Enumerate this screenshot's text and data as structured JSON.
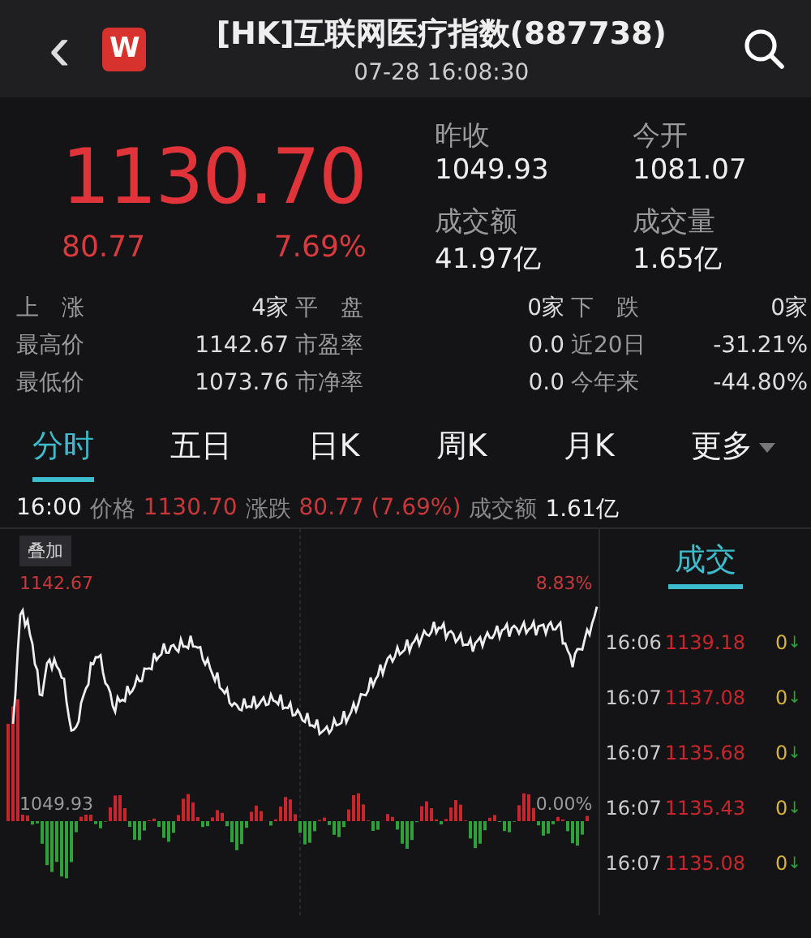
{
  "header": {
    "back": "‹",
    "logo": "W",
    "title": "[HK]互联网医疗指数(887738)",
    "time": "07-28 16:08:30"
  },
  "quote": {
    "price": "1130.70",
    "change": "80.77",
    "percent": "7.69%"
  },
  "summary": [
    {
      "label": "昨收",
      "value": "1049.93"
    },
    {
      "label": "今开",
      "value": "1081.07"
    },
    {
      "label": "成交额",
      "value": "41.97亿"
    },
    {
      "label": "成交量",
      "value": "1.65亿"
    }
  ],
  "stats": [
    {
      "label": "上　涨",
      "value": "4家"
    },
    {
      "label": "平　盘",
      "value": "0家"
    },
    {
      "label": "下　跌",
      "value": "0家"
    },
    {
      "label": "最高价",
      "value": "1142.67"
    },
    {
      "label": "市盈率",
      "value": "0.0"
    },
    {
      "label": "近20日",
      "value": "-31.21%"
    },
    {
      "label": "最低价",
      "value": "1073.76"
    },
    {
      "label": "市净率",
      "value": "0.0"
    },
    {
      "label": "今年来",
      "value": "-44.80%"
    }
  ],
  "tabs": [
    {
      "label": "分时",
      "selected": true
    },
    {
      "label": "五日",
      "selected": false
    },
    {
      "label": "日K",
      "selected": false
    },
    {
      "label": "周K",
      "selected": false
    },
    {
      "label": "月K",
      "selected": false
    },
    {
      "label": "更多",
      "selected": false,
      "dropdown": true
    }
  ],
  "info": {
    "time": "16:00",
    "price_label": "价格",
    "price": "1130.70",
    "change_label": "涨跌",
    "change": "80.77 (7.69%)",
    "amount_label": "成交额",
    "amount": "1.61亿"
  },
  "chart": {
    "overlay_button": "叠加",
    "high": "1142.67",
    "high_pct": "8.83%",
    "base": "1049.93",
    "base_pct": "0.00%"
  },
  "trades": {
    "tab": "成交",
    "rows": [
      {
        "time": "16:06",
        "price": "1139.18",
        "volume": "0",
        "arrow": "↓"
      },
      {
        "time": "16:07",
        "price": "1137.08",
        "volume": "0",
        "arrow": "↓"
      },
      {
        "time": "16:07",
        "price": "1135.68",
        "volume": "0",
        "arrow": "↓"
      },
      {
        "time": "16:07",
        "price": "1135.43",
        "volume": "0",
        "arrow": "↓"
      },
      {
        "time": "16:07",
        "price": "1135.08",
        "volume": "0",
        "arrow": "↓"
      }
    ]
  }
}
